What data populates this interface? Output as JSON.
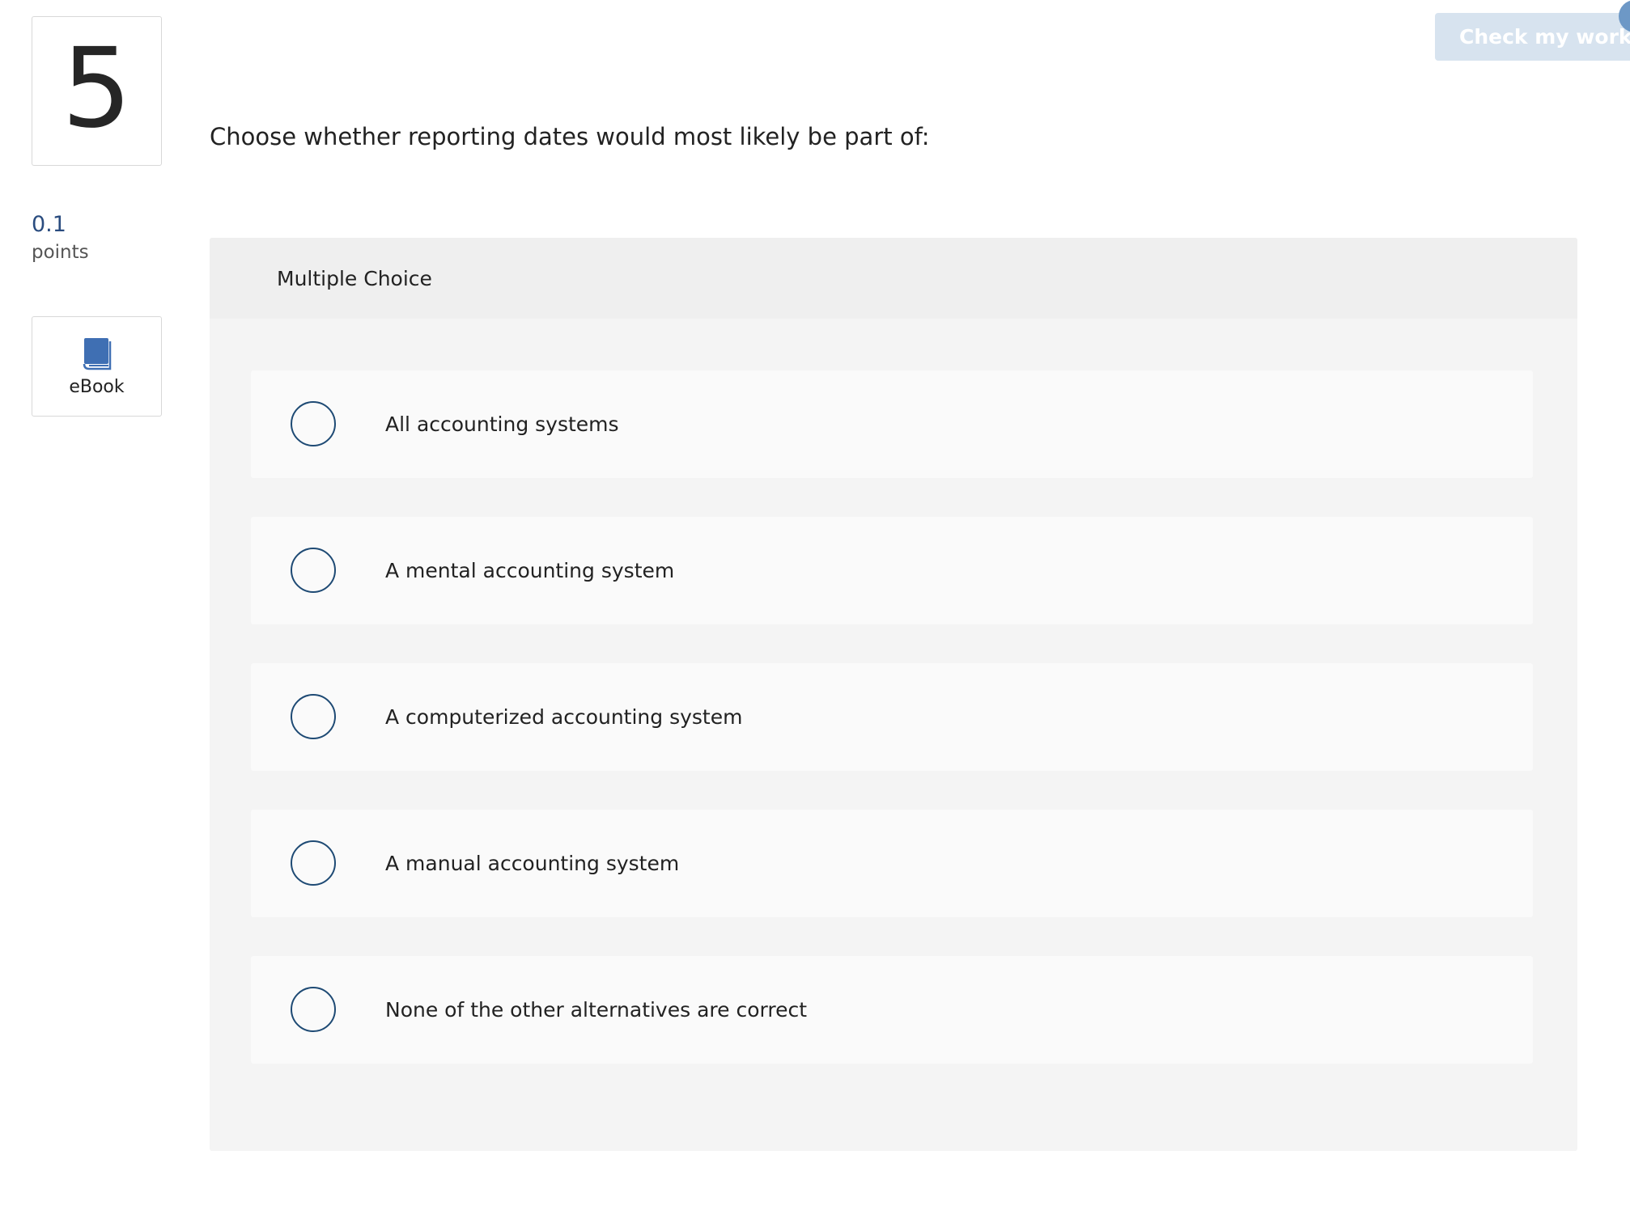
{
  "question": {
    "number": "5",
    "points_value": "0.1",
    "points_label": "points",
    "prompt": "Choose whether reporting dates would most likely be part of:",
    "type_label": "Multiple Choice"
  },
  "sidebar": {
    "ebook_label": "eBook",
    "ebook_icon": "book-icon"
  },
  "toolbar": {
    "check_label": "Check my work"
  },
  "options": [
    {
      "label": "All accounting systems",
      "selected": false
    },
    {
      "label": "A mental accounting system",
      "selected": false
    },
    {
      "label": "A computerized accounting system",
      "selected": false
    },
    {
      "label": "A manual accounting system",
      "selected": false
    },
    {
      "label": "None of the other alternatives are correct",
      "selected": false
    }
  ],
  "colors": {
    "accent": "#1e4a74",
    "points": "#2a4c7f",
    "button_bg": "#d7e3ef",
    "icon_blue": "#3f6fb3"
  }
}
